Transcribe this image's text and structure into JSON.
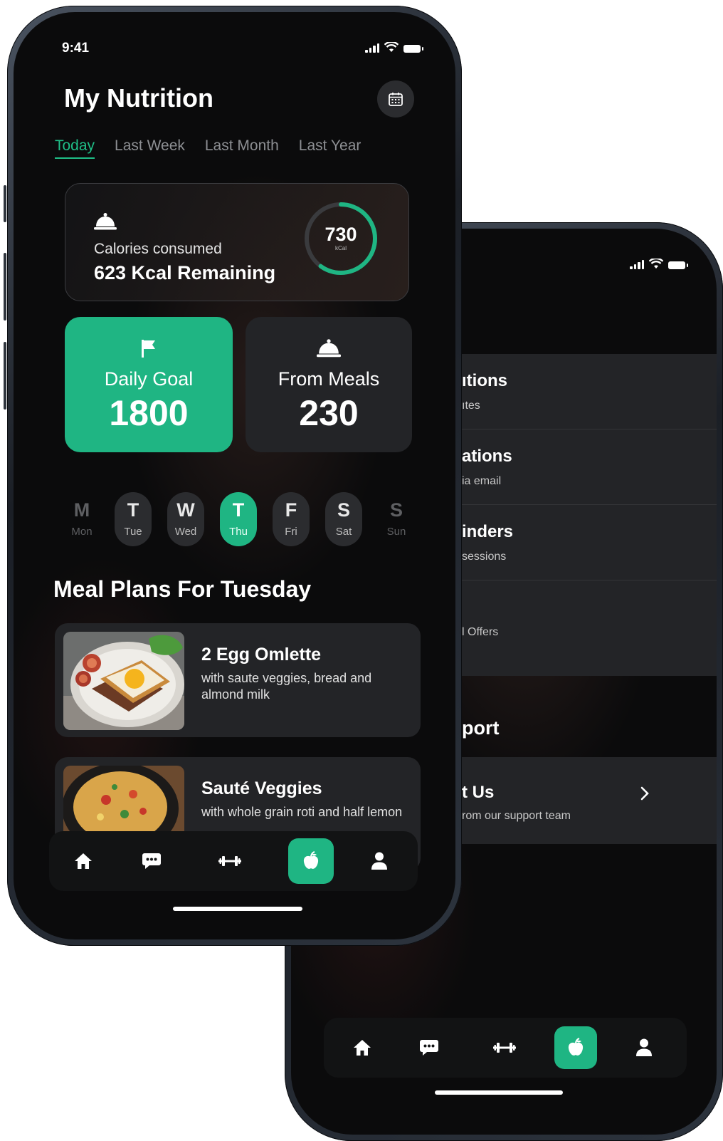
{
  "front": {
    "status": {
      "time": "9:41"
    },
    "header": {
      "title": "My Nutrition"
    },
    "tabs": [
      {
        "label": "Today",
        "active": true
      },
      {
        "label": "Last Week",
        "active": false
      },
      {
        "label": "Last Month",
        "active": false
      },
      {
        "label": "Last Year",
        "active": false
      }
    ],
    "calories": {
      "label": "Calories consumed",
      "remaining": "623 Kcal Remaining",
      "ring_value": "730",
      "ring_unit": "kCal",
      "ring_progress": 0.6
    },
    "daily_goal": {
      "label": "Daily Goal",
      "value": "1800"
    },
    "from_meals": {
      "label": "From Meals",
      "value": "230"
    },
    "days": [
      {
        "letter": "M",
        "short": "Mon",
        "state": "dim"
      },
      {
        "letter": "T",
        "short": "Tue",
        "state": "pill"
      },
      {
        "letter": "W",
        "short": "Wed",
        "state": "pill"
      },
      {
        "letter": "T",
        "short": "Thu",
        "state": "selected"
      },
      {
        "letter": "F",
        "short": "Fri",
        "state": "pill"
      },
      {
        "letter": "S",
        "short": "Sat",
        "state": "pill"
      },
      {
        "letter": "S",
        "short": "Sun",
        "state": "dim"
      }
    ],
    "section_title": "Meal Plans For Tuesday",
    "meals": [
      {
        "name": "2 Egg Omlette",
        "desc": "with saute veggies, bread and almond milk"
      },
      {
        "name": "Sauté Veggies",
        "desc": "with whole grain roti and half lemon"
      }
    ],
    "nav": [
      "home-icon",
      "chat-icon",
      "dumbbell-icon",
      "apple-icon",
      "profile-icon"
    ],
    "nav_active": "apple-icon"
  },
  "back": {
    "settings": [
      {
        "title": "ıtions",
        "sub": "ıtes",
        "toggle": true
      },
      {
        "title": "ations",
        "sub": "ia email",
        "toggle": true
      },
      {
        "title": "inders",
        "sub": "sessions",
        "toggle": true
      },
      {
        "title": "",
        "sub": "l Offers",
        "toggle": true
      }
    ],
    "support_title": "port",
    "contact": {
      "title": "t Us",
      "sub": "rom our support team"
    }
  },
  "colors": {
    "accent": "#1fb583",
    "toggle_on": "#2ec653",
    "card": "#232427",
    "background": "#0b0b0c"
  }
}
